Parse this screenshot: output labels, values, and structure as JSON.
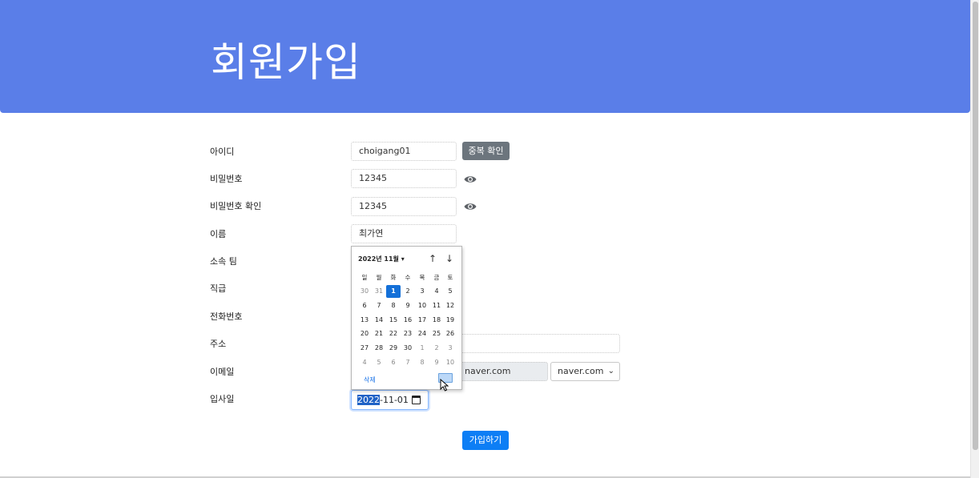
{
  "header": {
    "title": "회원가입"
  },
  "form": {
    "labels": [
      "아이디",
      "비밀번호",
      "비밀번호 확인",
      "이름",
      "소속 팀",
      "직급",
      "전화번호",
      "주소",
      "이메일",
      "입사일"
    ],
    "id_value": "choigang01",
    "duplicate_check_label": "중복 확인",
    "password_value": "12345",
    "password_confirm_value": "12345",
    "name_value": "최가연",
    "email_domain_value": "naver.com",
    "email_domain_select": "naver.com",
    "hire_date_year": "2022",
    "hire_date_rest": "-11-01",
    "submit_label": "가입하기"
  },
  "datepicker": {
    "month_label": "2022년 11월",
    "weekdays": [
      "일",
      "월",
      "화",
      "수",
      "목",
      "금",
      "토"
    ],
    "weeks": [
      [
        "30",
        "31",
        "1",
        "2",
        "3",
        "4",
        "5"
      ],
      [
        "6",
        "7",
        "8",
        "9",
        "10",
        "11",
        "12"
      ],
      [
        "13",
        "14",
        "15",
        "16",
        "17",
        "18",
        "19"
      ],
      [
        "20",
        "21",
        "22",
        "23",
        "24",
        "25",
        "26"
      ],
      [
        "27",
        "28",
        "29",
        "30",
        "1",
        "2",
        "3"
      ],
      [
        "4",
        "5",
        "6",
        "7",
        "8",
        "9",
        "10"
      ]
    ],
    "selected_day": "1",
    "clear_label": "삭제"
  },
  "colors": {
    "header_bg": "#5a7ee8",
    "primary": "#0d7ef5",
    "secondary": "#6c757d"
  },
  "icons": [
    "eye-icon",
    "calendar-icon",
    "arrow-up-icon",
    "arrow-down-icon",
    "caret-down-icon",
    "chevron-down-icon",
    "mouse-cursor-icon"
  ]
}
